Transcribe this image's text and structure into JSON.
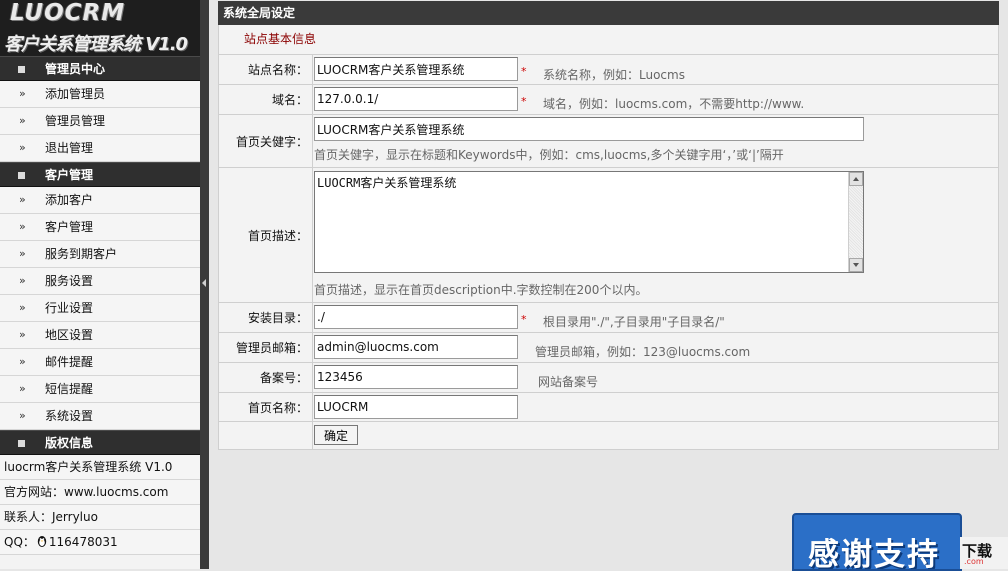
{
  "logo": {
    "main": "LUOCRM",
    "sub": "客户关系管理系统 V1.0"
  },
  "sidebar": {
    "sections": [
      {
        "title": "管理员中心",
        "items": [
          "添加管理员",
          "管理员管理",
          "退出管理"
        ]
      },
      {
        "title": "客户管理",
        "items": [
          "添加客户",
          "客户管理",
          "服务到期客户",
          "服务设置",
          "行业设置",
          "地区设置",
          "邮件提醒",
          "短信提醒",
          "系统设置"
        ]
      }
    ],
    "bullet": "»",
    "copyright": {
      "title": "版权信息",
      "product": "luocrm客户关系管理系统  V1.0",
      "site_label": "官方网站：",
      "site_url": "www.luocms.com",
      "contact": "联系人：Jerryluo",
      "qq_label": "QQ：",
      "qq": "116478031"
    }
  },
  "panel": {
    "title": "系统全局设定",
    "section": "站点基本信息",
    "fields": {
      "site_name": {
        "label": "站点名称：",
        "value": "LUOCRM客户关系管理系统",
        "hint": "系统名称，例如：Luocms"
      },
      "domain": {
        "label": "域名：",
        "value": "127.0.0.1/",
        "hint": "域名，例如：luocms.com，不需要http://www."
      },
      "keywords": {
        "label": "首页关健字：",
        "value": "LUOCRM客户关系管理系统",
        "hint": "首页关健字，显示在标题和Keywords中，例如：cms,luocms,多个关键字用‘，’或‘|’隔开"
      },
      "description": {
        "label": "首页描述：",
        "value": "LUOCRM客户关系管理系统",
        "hint": "首页描述，显示在首页description中.字数控制在200个以内。"
      },
      "install_dir": {
        "label": "安装目录：",
        "value": "./",
        "hint": "根目录用\"./\",子目录用\"子目录名/\""
      },
      "admin_email": {
        "label": "管理员邮箱：",
        "value": "admin@luocms.com",
        "hint": "管理员邮箱，例如：123@luocms.com"
      },
      "icp": {
        "label": "备案号：",
        "value": "123456",
        "hint": "网站备案号"
      },
      "home_name": {
        "label": "首页名称：",
        "value": "LUOCRM"
      }
    },
    "required_mark": "*",
    "submit_label": "确定"
  },
  "badge": {
    "text": "感谢支持",
    "side_text": "下载",
    "side_small": ".com"
  }
}
